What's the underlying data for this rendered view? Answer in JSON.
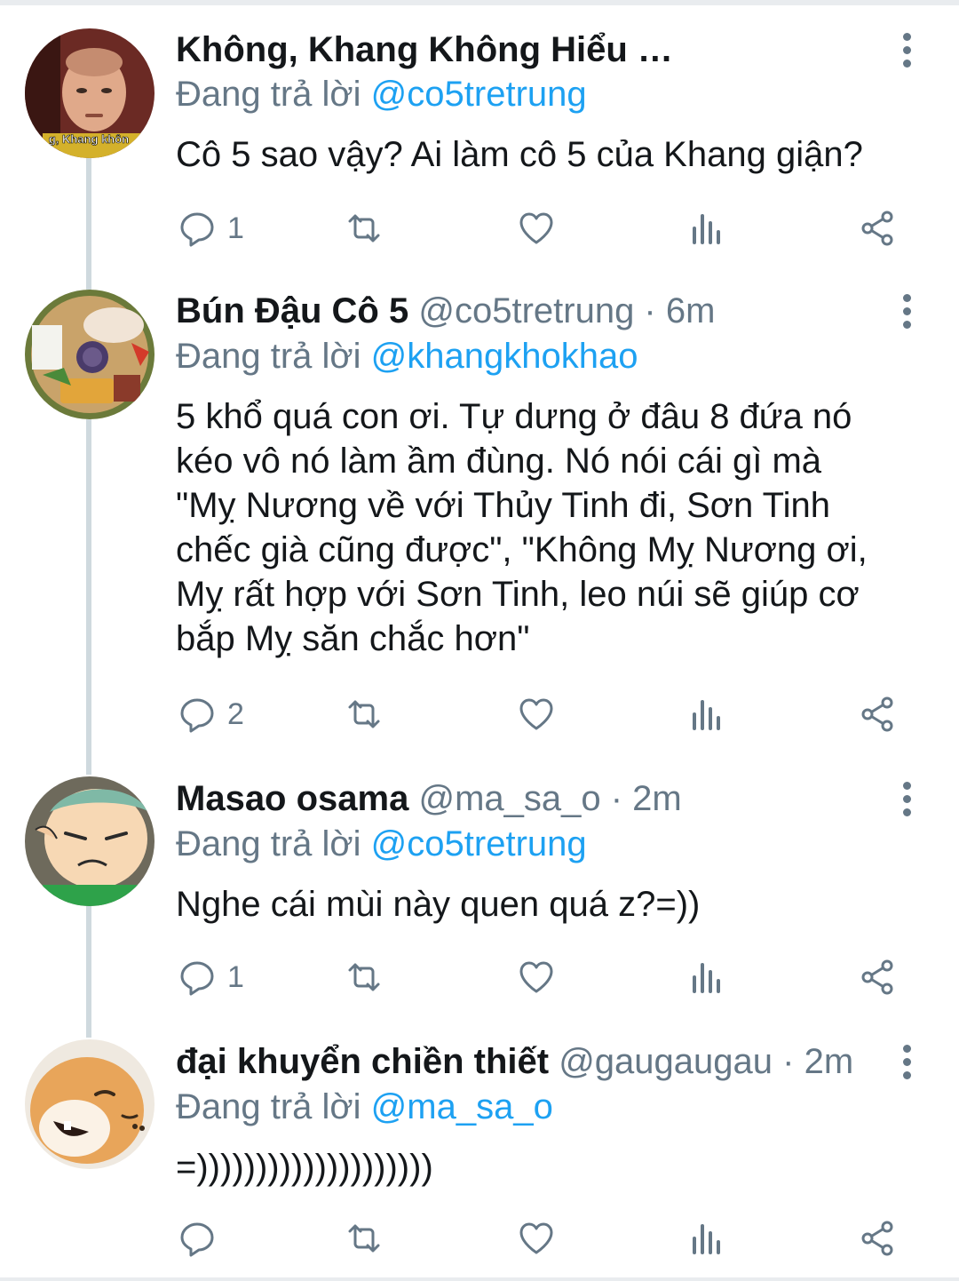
{
  "tweets": [
    {
      "name": "Không, Khang Không Hiểu …",
      "handle": "",
      "time": "",
      "reply_prefix": "Đang trả lời",
      "reply_to": "@co5tretrung",
      "text": "Cô 5 sao vậy? Ai làm cô 5 của Khang giận?",
      "avatar_caption": "g, Khang khôn",
      "reply_count": "1"
    },
    {
      "name": "Bún Đậu Cô 5",
      "handle": "@co5tretrung",
      "time": "6m",
      "reply_prefix": "Đang trả lời",
      "reply_to": "@khangkhokhao",
      "text": "5 khổ quá con ơi. Tự dưng ở đâu 8 đứa nó\nkéo vô nó làm ầm đùng. Nó nói cái gì mà\n\"Mỵ Nương về với Thủy Tinh đi, Sơn Tinh\nchếc già cũng được\", \"Không Mỵ Nương ơi,\nMỵ rất hợp với Sơn Tinh, leo núi sẽ giúp cơ\nbắp Mỵ săn chắc hơn\"",
      "reply_count": "2"
    },
    {
      "name": "Masao osama",
      "handle": "@ma_sa_o",
      "time": "2m",
      "reply_prefix": "Đang trả lời",
      "reply_to": "@co5tretrung",
      "text": "Nghe cái mùi này quen quá z?=))",
      "reply_count": "1"
    },
    {
      "name": "đại khuyển chiền thiết",
      "handle": "@gaugaugau",
      "time": "2m",
      "reply_prefix": "Đang trả lời",
      "reply_to": "@ma_sa_o",
      "text": "=))))))))))))))))))))",
      "reply_count": ""
    }
  ],
  "separator": " · ",
  "icons": {
    "reply": "reply-bubble-icon",
    "retweet": "retweet-icon",
    "like": "heart-icon",
    "analytics": "analytics-icon",
    "share": "share-icon",
    "more": "more-vertical-icon"
  },
  "colors": {
    "link": "#1da1f2",
    "secondary_text": "#657786",
    "thread_line": "#cfd9de"
  }
}
